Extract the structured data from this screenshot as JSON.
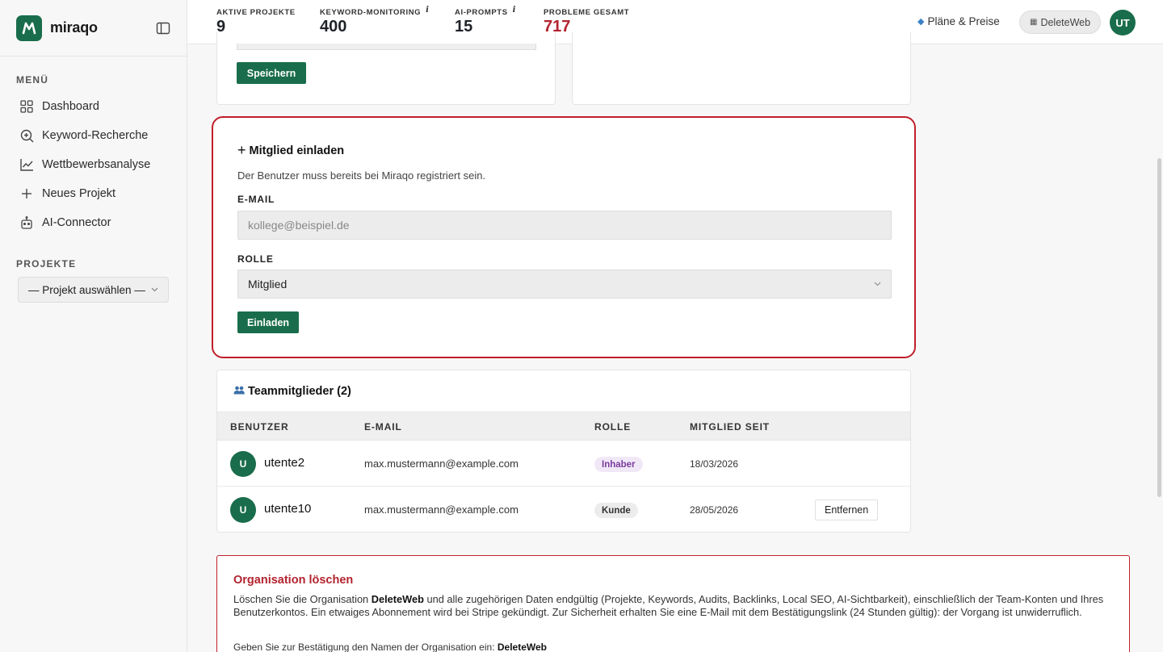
{
  "brand": {
    "name": "miraqo",
    "logo_letter": "M",
    "accent": "#1a6d4c"
  },
  "sidebar": {
    "menu_label": "MENÜ",
    "items": [
      {
        "label": "Dashboard",
        "icon": "grid-icon"
      },
      {
        "label": "Keyword-Recherche",
        "icon": "search-plus-icon"
      },
      {
        "label": "Wettbewerbsanalyse",
        "icon": "line-chart-icon"
      },
      {
        "label": "Neues Projekt",
        "icon": "plus-icon"
      },
      {
        "label": "AI-Connector",
        "icon": "robot-icon"
      }
    ],
    "projects_label": "PROJEKTE",
    "project_select": "— Projekt auswählen —"
  },
  "header": {
    "stats": [
      {
        "label": "AKTIVE PROJEKTE",
        "value": "9",
        "info": ""
      },
      {
        "label": "KEYWORD-MONITORING",
        "value": "400",
        "info": "i"
      },
      {
        "label": "AI-PROMPTS",
        "value": "15",
        "info": "i"
      },
      {
        "label": "PROBLEME GESAMT",
        "value": "717",
        "info": "",
        "color": "#b3232e"
      }
    ],
    "plans_label": "Pläne & Preise",
    "org_name": "DeleteWeb",
    "user_initials": "UT"
  },
  "top_card": {
    "save_label": "Speichern"
  },
  "invite": {
    "title": "Mitglied einladen",
    "hint": "Der Benutzer muss bereits bei Miraqo registriert sein.",
    "email_label": "E-MAIL",
    "email_placeholder": "kollege@beispiel.de",
    "role_label": "ROLLE",
    "role_value": "Mitglied",
    "submit_label": "Einladen"
  },
  "team": {
    "title": "Teammitglieder (2)",
    "columns": [
      "BENUTZER",
      "E-MAIL",
      "ROLLE",
      "MITGLIED SEIT"
    ],
    "rows": [
      {
        "initial": "U",
        "name": "utente2",
        "email": "max.mustermann@example.com",
        "role": "Inhaber",
        "since": "18/03/2026",
        "action": ""
      },
      {
        "initial": "U",
        "name": "utente10",
        "email": "max.mustermann@example.com",
        "role": "Kunde",
        "since": "28/05/2026",
        "action": "Entfernen"
      }
    ]
  },
  "danger": {
    "title": "Organisation löschen",
    "text_1": "Löschen Sie die Organisation ",
    "org": "DeleteWeb",
    "text_2": " und alle zugehörigen Daten endgültig (Projekte, Keywords, Audits, Backlinks, Local SEO, AI-Sichtbarkeit), einschließlich der Team-Konten und Ihres Benutzerkontos. Ein etwaiges Abonnement wird bei Stripe gekündigt. Zur Sicherheit erhalten Sie eine E-Mail mit dem Bestätigungslink (24 Stunden gültig): der Vorgang ist unwiderruflich.",
    "confirm_prefix": "Geben Sie zur Bestätigung den Namen der Organisation ein: ",
    "confirm_name": "DeleteWeb"
  }
}
